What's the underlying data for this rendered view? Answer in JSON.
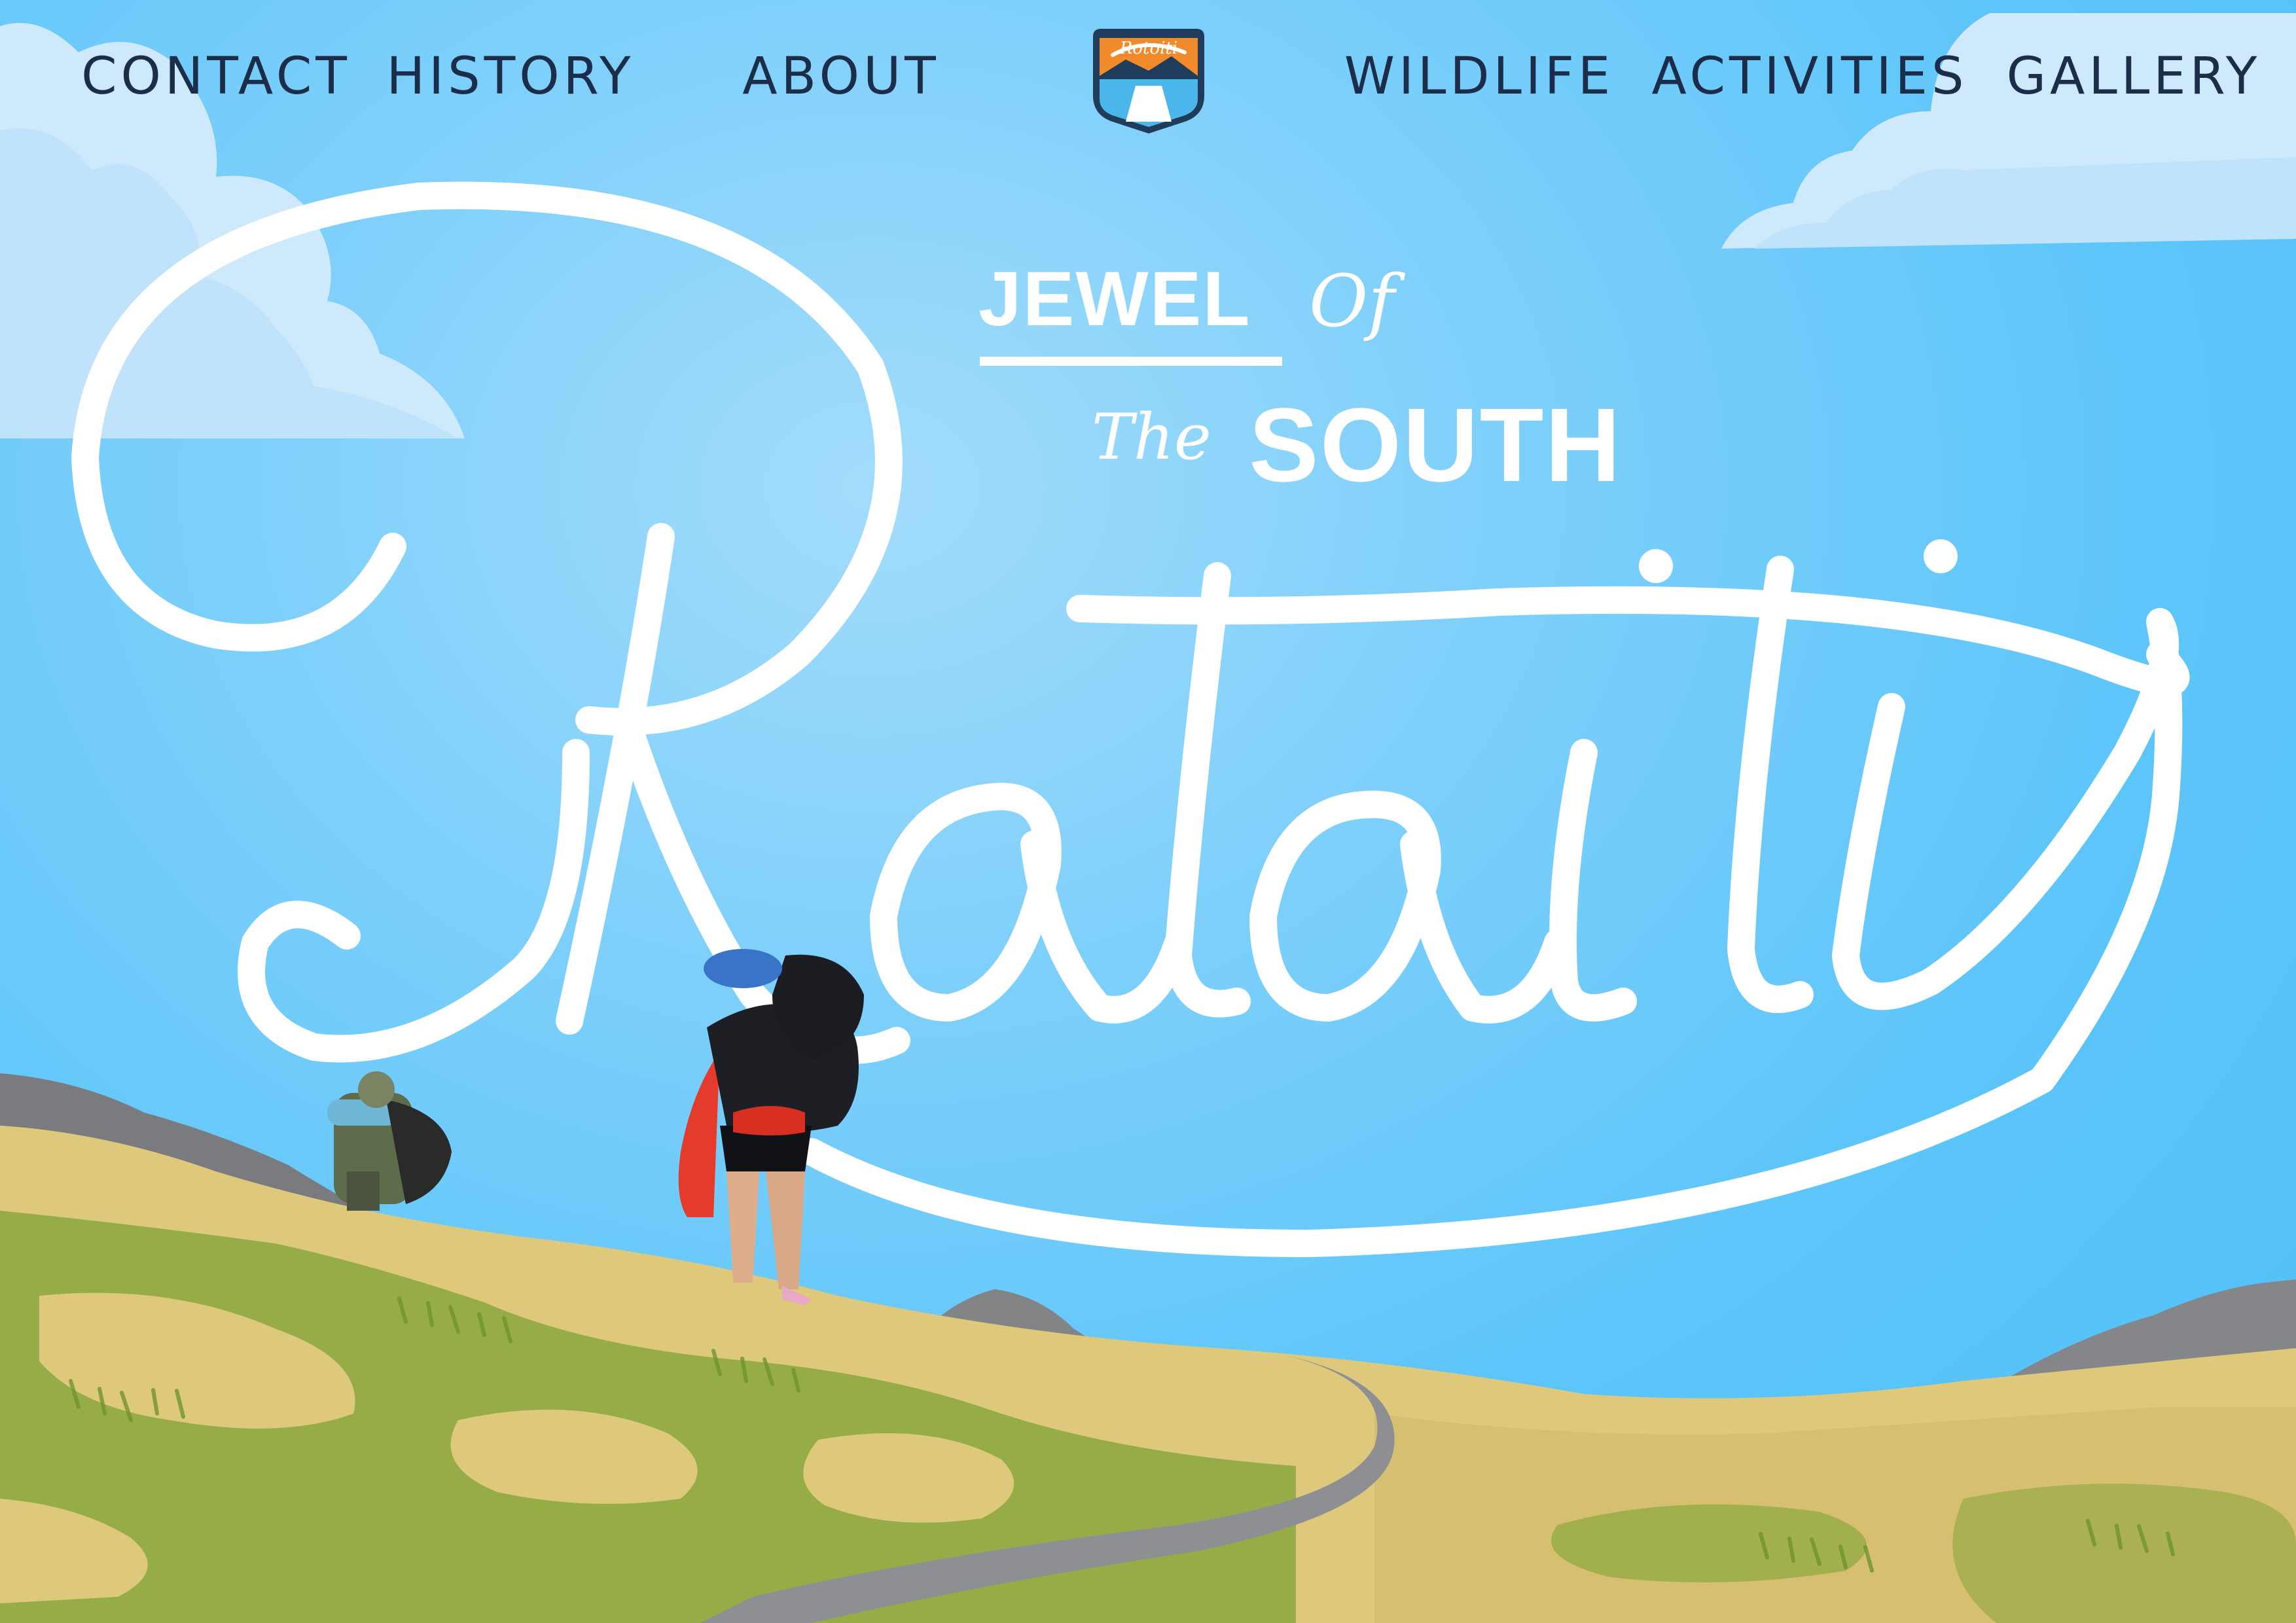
{
  "nav": {
    "items": [
      {
        "label": "CONTACT"
      },
      {
        "label": "HISTORY"
      },
      {
        "label": "ABOUT"
      },
      {
        "label": "WILDLIFE"
      },
      {
        "label": "ACTIVITIES"
      },
      {
        "label": "GALLERY"
      }
    ],
    "logo_text": "Rotoiti"
  },
  "hero": {
    "tagline_word1": "JEWEL",
    "tagline_word2": "Of",
    "tagline_word3": "The",
    "tagline_word4": "SOUTH",
    "title": "Rotoiti"
  },
  "colors": {
    "sky": "#5ec8fb",
    "nav_text": "#1c2d4a",
    "hero_text": "#ffffff",
    "grass_sand": "#dcc77a",
    "grass_green": "#8caa3c",
    "path": "#8e8f92",
    "rock": "#8a8a8c",
    "logo_orange": "#f08a2a",
    "logo_navy": "#1f3c5a"
  }
}
